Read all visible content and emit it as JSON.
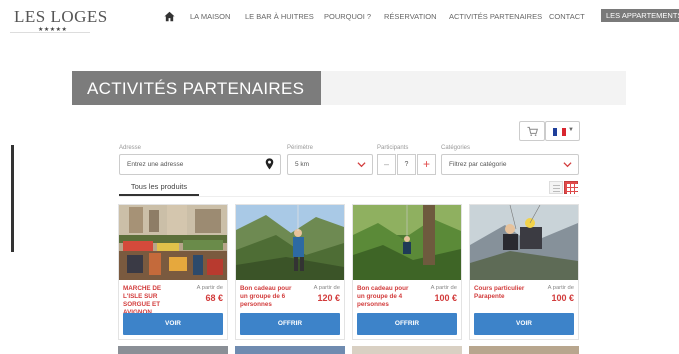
{
  "header": {
    "logo_text": "LES LOGES",
    "logo_stars": "★★★★★",
    "nav": [
      "LA MAISON",
      "LE BAR À HUITRES",
      "POURQUOI ?",
      "RÉSERVATION",
      "ACTIVITÉS PARTENAIRES",
      "CONTACT",
      "LES APPARTEMENTS"
    ]
  },
  "page": {
    "title": "ACTIVITÉS PARTENAIRES"
  },
  "filters": {
    "address_label": "Adresse",
    "address_placeholder": "Entrez une adresse",
    "perimeter_label": "Périmètre",
    "perimeter_value": "5 km",
    "participants_label": "Participants",
    "participants_value": "?",
    "minus": "–",
    "plus": "+",
    "category_label": "Catégories",
    "category_value": "Filtrez par catégorie"
  },
  "tabs": {
    "all_products": "Tous les produits"
  },
  "colors": {
    "accent_red": "#d23c3c",
    "button_blue": "#3d83c9",
    "title_grey": "#7c7c7c"
  },
  "products": [
    {
      "title": "MARCHE DE L'ISLE SUR SORGUE ET AVIGNON",
      "from": "A partir de",
      "price": "68 €",
      "button": "VOIR"
    },
    {
      "title": "Bon cadeau pour un groupe de 6 personnes",
      "from": "A partir de",
      "price": "120 €",
      "button": "OFFRIR"
    },
    {
      "title": "Bon cadeau pour un groupe de 4 personnes",
      "from": "A partir de",
      "price": "100 €",
      "button": "OFFRIR"
    },
    {
      "title": "Cours particulier Parapente",
      "from": "A partir de",
      "price": "100 €",
      "button": "VOIR"
    }
  ]
}
